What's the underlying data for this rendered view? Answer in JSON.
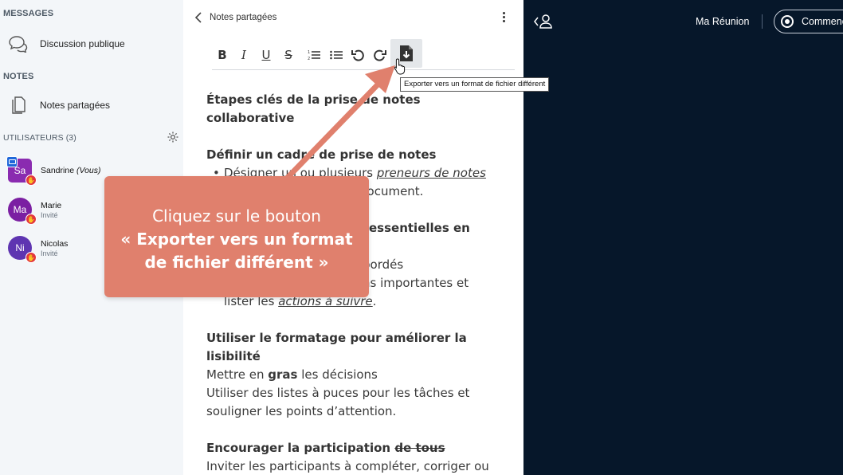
{
  "sidebar": {
    "messages_title": "MESSAGES",
    "public_chat_label": "Discussion publique",
    "notes_title": "NOTES",
    "shared_notes_label": "Notes partagées",
    "users_title": "UTILISATEURS (3)",
    "users": [
      {
        "initials": "Sa",
        "name": "Sandrine",
        "suffix": "(Vous)",
        "role": "",
        "color": "#8a2bb0"
      },
      {
        "initials": "Ma",
        "name": "Marie",
        "suffix": "",
        "role": "Invité",
        "color": "#7b1fa2"
      },
      {
        "initials": "Ni",
        "name": "Nicolas",
        "suffix": "",
        "role": "Invité",
        "color": "#5e35b1"
      }
    ]
  },
  "notes_panel": {
    "title": "Notes partagées",
    "toolbar": {
      "bold": "B",
      "italic": "I",
      "underline": "U",
      "strike": "S",
      "ordered_list": "☰",
      "bullet_list": "☰",
      "undo": "↶",
      "redo": "↷"
    },
    "export_tooltip": "Exporter vers un format de fichier différent",
    "document": {
      "h1_line1": "Étapes clés de la prise de notes",
      "h1_line2": "collaborative",
      "h2": "Définir un cadre de prise de notes",
      "b1_pre": "Désigner un ou plusieurs ",
      "b1_link": "preneurs de notes",
      "b1_line2": "document.",
      "h3_end": "essentielles en",
      "b2_end": "bordés",
      "b3_end": "ns importantes et",
      "b3_line2_pre": "lister les ",
      "b3_line2_link": "actions à suivre",
      "b3_line2_post": ".",
      "h4_line1": "Utiliser le formatage pour améliorer la",
      "h4_line2": "lisibilité",
      "p1_pre": "Mettre en ",
      "p1_bold": "gras",
      "p1_post": " les décisions",
      "p2_line1": "Utiliser des listes à puces pour les tâches et",
      "p2_line2": "souligner les points d’attention.",
      "h5_pre": "Encourager la participation ",
      "h5_strike": "de tous",
      "p3": "Inviter les participants à compléter, corriger ou"
    }
  },
  "topbar": {
    "meeting_name": "Ma Réunion",
    "start_label": "Commencer l'enregistrement"
  },
  "callout": {
    "line1": "Cliquez sur le bouton",
    "line2": "« Exporter vers un format",
    "line3": "de fichier différent »"
  },
  "colors": {
    "callout_bg": "#e0806d",
    "dark_bg": "#06172a",
    "sidebar_bg": "#f3f6f9",
    "badge_red": "#e4363f"
  }
}
